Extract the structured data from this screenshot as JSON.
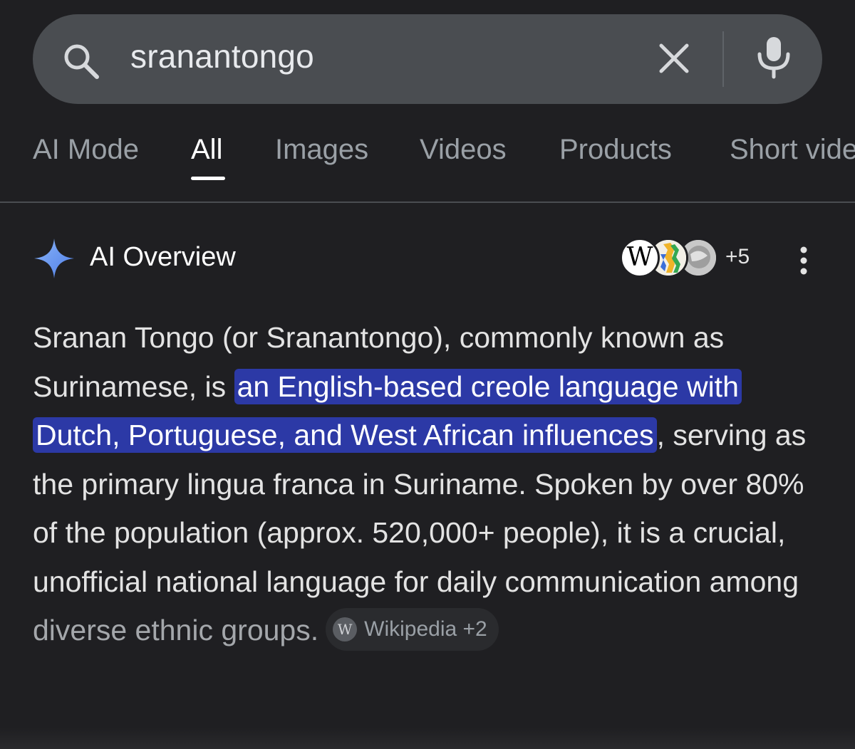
{
  "search": {
    "query": "sranantongo",
    "search_icon": "search-icon",
    "clear_icon": "close-icon",
    "mic_icon": "microphone-icon"
  },
  "tabs": [
    {
      "label": "AI Mode",
      "active": false
    },
    {
      "label": "All",
      "active": true
    },
    {
      "label": "Images",
      "active": false
    },
    {
      "label": "Videos",
      "active": false
    },
    {
      "label": "Products",
      "active": false
    },
    {
      "label": "Short vide",
      "active": false
    }
  ],
  "ai_overview": {
    "title": "AI Overview",
    "title_icon": "sparkle-icon",
    "sources": {
      "wiki_glyph": "W",
      "more_count": "+5"
    },
    "more_icon": "more-vertical-icon",
    "body": {
      "part1": "Sranan Tongo (or Sranantongo), commonly known as Surinamese, is ",
      "highlight": "an English-based creole language with Dutch, Portuguese, and West African influences",
      "part2": ", serving as the primary lingua franca in Suriname. Spoken by over 80% of the population (approx. 520,000+ people), it is a crucial, unofficial national language for daily communication among ",
      "faded": "diverse ethnic groups."
    },
    "citation": {
      "wiki_glyph": "W",
      "label": "Wikipedia +2"
    }
  },
  "colors": {
    "background": "#1f1f22",
    "search_bar": "#4a4d51",
    "highlight": "#2c39a6",
    "sparkle": "#6e9bf3"
  }
}
